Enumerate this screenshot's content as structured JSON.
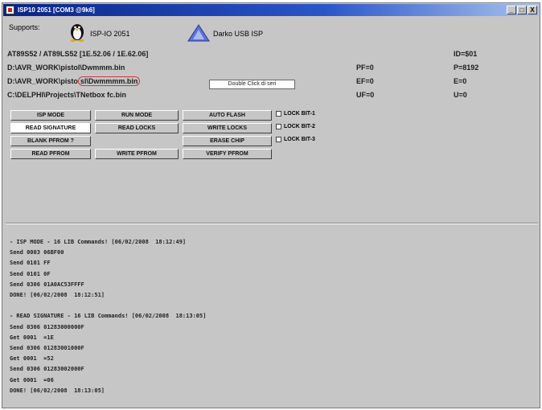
{
  "window": {
    "title": "ISP10 2051 [COM3 @9k6]",
    "buttons": [
      "_",
      "□",
      "X"
    ]
  },
  "supports": {
    "label": "Supports:",
    "isp_label": "ISP-IO 2051",
    "programmer_label": "Darko USB ISP"
  },
  "info": {
    "device_line": "AT89S52 / AT89LS52 [1E.52.06 / 1E.62.06]",
    "file1": "D:\\AVR_WORK\\pistol\\Dwmmm.bin",
    "file2_prefix": "D:\\AVR_WORK\\pisto",
    "file2_highlight": "sl\\Dwmmmm.bin",
    "file3": "C:\\DELPHI\\Projects\\TNetbox fc.bin",
    "double_click_tip": "Double Click di seri",
    "fuses": {
      "r1_right": "ID=$01",
      "r2_left": "PF=0",
      "r2_right": "P=8192",
      "r3_left": "EF=0",
      "r3_right": "E=0",
      "r4_left": "UF=0",
      "r4_right": "U=0"
    }
  },
  "buttons": {
    "isp_mode": "ISP MODE",
    "run_mode": "RUN MODE",
    "auto_flash": "AUTO FLASH",
    "read_signature": "READ SIGNATURE",
    "read_locks": "READ LOCKS",
    "write_locks": "WRITE LOCKS",
    "blank_prom": "BLANK PFROM ?",
    "erase_chip": "ERASE CHIP",
    "read_prom": "READ PFROM",
    "write_prom": "WRITE PFROM",
    "verify_prom": "VERIFY PFROM"
  },
  "lock_bits": [
    "LOCK BIT-1",
    "LOCK BIT-2",
    "LOCK BIT-3"
  ],
  "log_lines": [
    "- ISP MODE - 16 LIB Commands! [06/02/2008  18:12:49]",
    "Send 0003 06BF00",
    "Send 0101 FF",
    "Send 0101 0F",
    "Send 0306 01A0AC53FFFF",
    "DONE! [06/02/2008  18:12:51]",
    "",
    "- READ SIGNATURE - 16 LIB Commands! [06/02/2008  18:13:05]",
    "Send 0306 01283000000F",
    "Get 0001  =1E",
    "Send 0306 01283001000F",
    "Get 0001  =52",
    "Send 0306 01283002000F",
    "Get 0001  =06",
    "DONE! [06/02/2008  18:13:05]"
  ]
}
